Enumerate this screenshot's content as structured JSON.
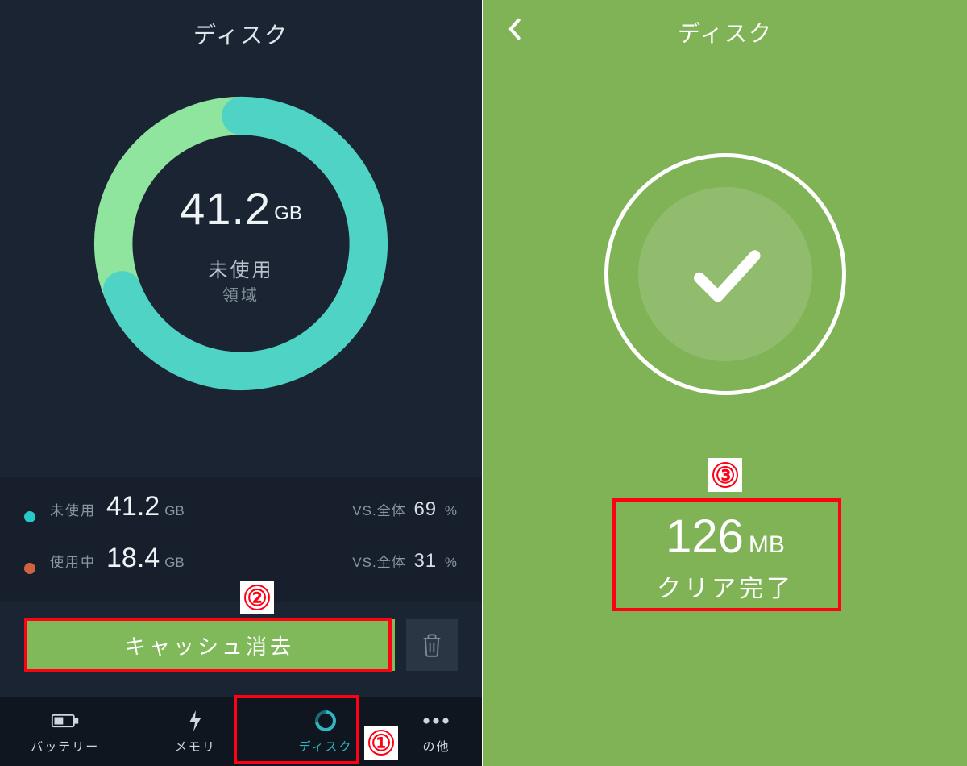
{
  "left": {
    "title": "ディスク",
    "gauge": {
      "value": "41.2",
      "unit": "GB",
      "label_main": "未使用",
      "label_sub": "領域",
      "free_pct": 69
    },
    "stats": {
      "vs_label": "VS.全体",
      "pct_sign": "%",
      "free": {
        "label": "未使用",
        "value": "41.2",
        "unit": "GB",
        "pct": "69"
      },
      "used": {
        "label": "使用中",
        "value": "18.4",
        "unit": "GB",
        "pct": "31"
      }
    },
    "clear_button": "キャッシュ消去",
    "tabs": {
      "battery": "バッテリー",
      "memory": "メモリ",
      "disk": "ディスク",
      "other": "の他"
    }
  },
  "right": {
    "title": "ディスク",
    "result_value": "126",
    "result_unit": "MB",
    "result_done": "クリア完了"
  },
  "annotations": {
    "n1": "①",
    "n2": "②",
    "n3": "③"
  },
  "chart_data": {
    "type": "pie",
    "title": "ディスク",
    "series": [
      {
        "name": "未使用",
        "value": 41.2,
        "unit": "GB",
        "pct": 69,
        "color": "#5fd6c0"
      },
      {
        "name": "使用中",
        "value": 18.4,
        "unit": "GB",
        "pct": 31,
        "color": "#8ee39a"
      }
    ]
  }
}
